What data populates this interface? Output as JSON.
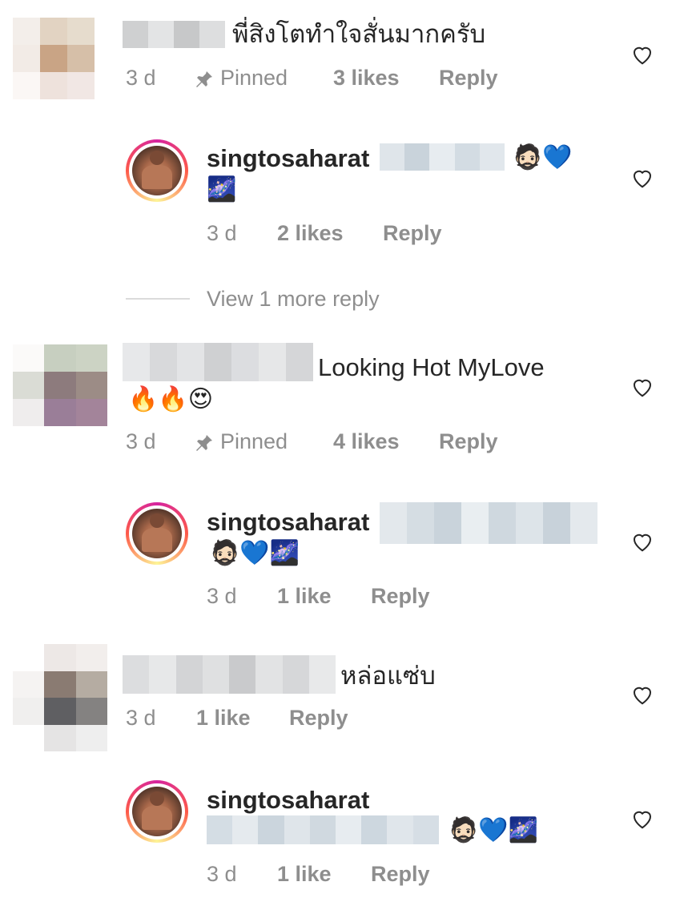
{
  "colors": {
    "primary_text": "#262626",
    "secondary_text": "#8e8e8e",
    "divider": "#dbdbdb"
  },
  "comments": [
    {
      "text": "พี่สิงโตทำใจสั่นมากครับ",
      "time": "3 d",
      "pinned_label": "Pinned",
      "likes": "3 likes",
      "reply_label": "Reply",
      "reply": {
        "username": "singtosaharat",
        "emojis": "🧔🏻💙",
        "emojis_line2": "🌌",
        "time": "3 d",
        "likes": "2 likes",
        "reply_label": "Reply"
      },
      "view_more": "View 1 more reply"
    },
    {
      "text": "Looking Hot MyLove",
      "emojis": "🔥🔥😍",
      "time": "3 d",
      "pinned_label": "Pinned",
      "likes": "4 likes",
      "reply_label": "Reply",
      "reply": {
        "username": "singtosaharat",
        "emojis": "🧔🏻💙🌌",
        "time": "3 d",
        "likes": "1 like",
        "reply_label": "Reply"
      }
    },
    {
      "text": "หล่อแซ่บ",
      "time": "3 d",
      "likes": "1 like",
      "reply_label": "Reply",
      "reply": {
        "username": "singtosaharat",
        "emojis": "🧔🏻💙🌌",
        "time": "3 d",
        "likes": "1 like",
        "reply_label": "Reply"
      }
    }
  ]
}
